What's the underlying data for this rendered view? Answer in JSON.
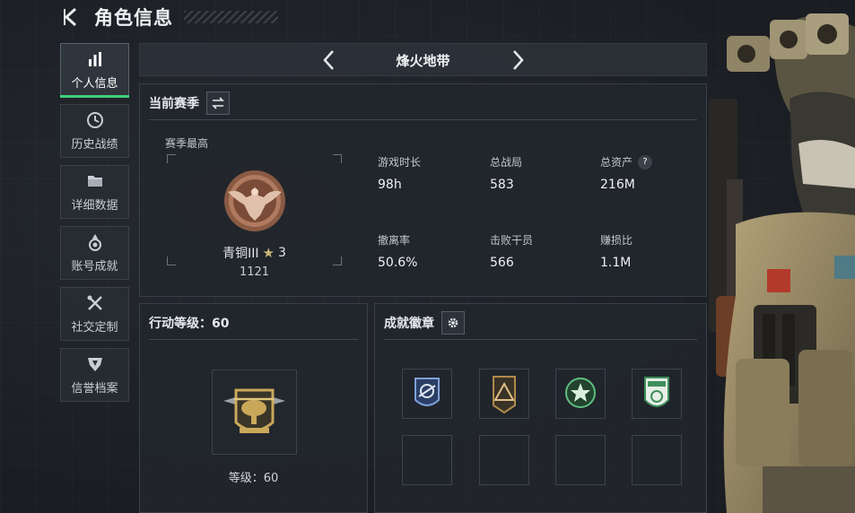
{
  "header": {
    "title": "角色信息"
  },
  "sidebar": {
    "items": [
      {
        "label": "个人信息",
        "icon": "bar-chart-icon"
      },
      {
        "label": "历史战绩",
        "icon": "clock-icon"
      },
      {
        "label": "详细数据",
        "icon": "folder-icon"
      },
      {
        "label": "账号成就",
        "icon": "medal-icon"
      },
      {
        "label": "社交定制",
        "icon": "tools-icon"
      },
      {
        "label": "信誉档案",
        "icon": "shield-icon"
      }
    ],
    "active_index": 0
  },
  "mode": {
    "title": "烽火地带"
  },
  "season": {
    "title": "当前赛季",
    "subtitle": "赛季最高",
    "rank_name": "青铜III",
    "rank_stars": "3",
    "rank_score": "1121",
    "stats": [
      {
        "label": "游戏时长",
        "value": "98h"
      },
      {
        "label": "总战局",
        "value": "583"
      },
      {
        "label": "总资产",
        "value": "216M",
        "help": "?"
      },
      {
        "label": "撤离率",
        "value": "50.6%"
      },
      {
        "label": "击败干员",
        "value": "566"
      },
      {
        "label": "赚损比",
        "value": "1.1M"
      }
    ]
  },
  "level": {
    "title": "行动等级：60",
    "level_label": "等级：60"
  },
  "achievements": {
    "title": "成就徽章",
    "badges": [
      {
        "icon": "satellite-badge-icon",
        "color": "#3d6fb0"
      },
      {
        "icon": "triangle-badge-icon",
        "color": "#b08a4a"
      },
      {
        "icon": "star-wreath-badge-icon",
        "color": "#3f8f5a"
      },
      {
        "icon": "shield-badge-icon",
        "color": "#3f8f5a"
      }
    ]
  },
  "colors": {
    "accent": "#3fd07a",
    "background": "#1b1f24",
    "panel": "#22262c"
  }
}
